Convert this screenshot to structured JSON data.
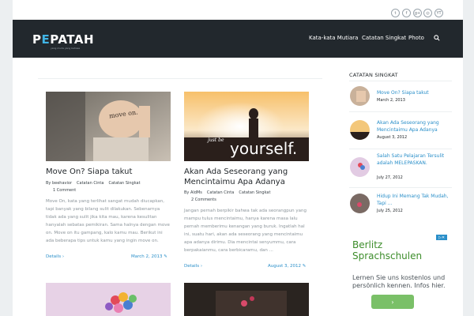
{
  "social": [
    "twitter-icon",
    "facebook-icon",
    "google-plus-icon",
    "instagram-icon",
    "youtube-icon"
  ],
  "social_glyphs": [
    "t",
    "f",
    "g+",
    "◎",
    "YT"
  ],
  "header": {
    "logo_pre": "P",
    "logo_e": "E",
    "logo_post": "PATAH",
    "tagline": "yang muda yang bahasa",
    "nav": [
      "Kata-kata Mutiara",
      "Catatan Singkat",
      "Photo"
    ]
  },
  "posts": [
    {
      "title": "Move On? Siapa takut",
      "by": "By beehavior",
      "cat1": "Catatan Cinta",
      "cat2": "Catatan Singkat",
      "comments": "1 Comment",
      "excerpt": "Move On, kata yang terlihat sangat mudah diucapkan, tapi banyak yang bilang sulit dilakukan. Sebenarnya tidak ada yang sulit jika kita mau, karena kesulitan hanyalah sebatas pemikiran. Sama halnya dengan move on. Move on itu gampang, kalo kamu mau. Berikut ini ada beberapa tips untuk kamu yang ingin move on.",
      "details": "Details",
      "date": "March 2, 2013",
      "image_text": "move on."
    },
    {
      "title": "Akan Ada Seseorang yang Mencintaimu Apa Adanya",
      "by": "By AldMs",
      "cat1": "Catatan Cinta",
      "cat2": "Catatan Singkat",
      "comments": "2 Comments",
      "excerpt": "Jangan pernah berpikir bahwa tak ada seorangpun yang mampu tulus mencintaimu, hanya karena masa lalu pernah memberimu kenangan yang buruk. Ingatlah hal ini, suatu hari, akan ada seseorang yang mencintaimu apa adanya dirimu. Dia mencintai senyummu, cara berpakaianmu, cara berbicaramu, dan ...",
      "details": "Details",
      "date": "August 3, 2012",
      "image_text_small": "just be",
      "image_text_big": "yourself."
    }
  ],
  "sidebar": {
    "title": "CATATAN SINGKAT",
    "items": [
      {
        "title": "Move On? Siapa takut",
        "date": "March 2, 2013"
      },
      {
        "title": "Akan Ada Seseorang yang Mencintaimu Apa Adanya",
        "date": "August 3, 2012"
      },
      {
        "title": "Salah Satu Pelajaran Tersulit adalah MELEPASKAN.",
        "date": "July 27, 2012"
      },
      {
        "title": "Hidup Ini Memang Tak Mudah, Tapi ...",
        "date": "July 25, 2012"
      }
    ]
  },
  "ad": {
    "headline1": "Berlitz",
    "headline2": "Sprachschulen",
    "text": "Lernen Sie uns kostenlos und persönlich kennen. Infos hier.",
    "button": "›",
    "badge": "▷✕"
  },
  "colors": {
    "header_bg": "#22282d",
    "accent": "#2a8fc9",
    "logo_accent": "#40b4e5",
    "ad_green": "#7ac068"
  }
}
